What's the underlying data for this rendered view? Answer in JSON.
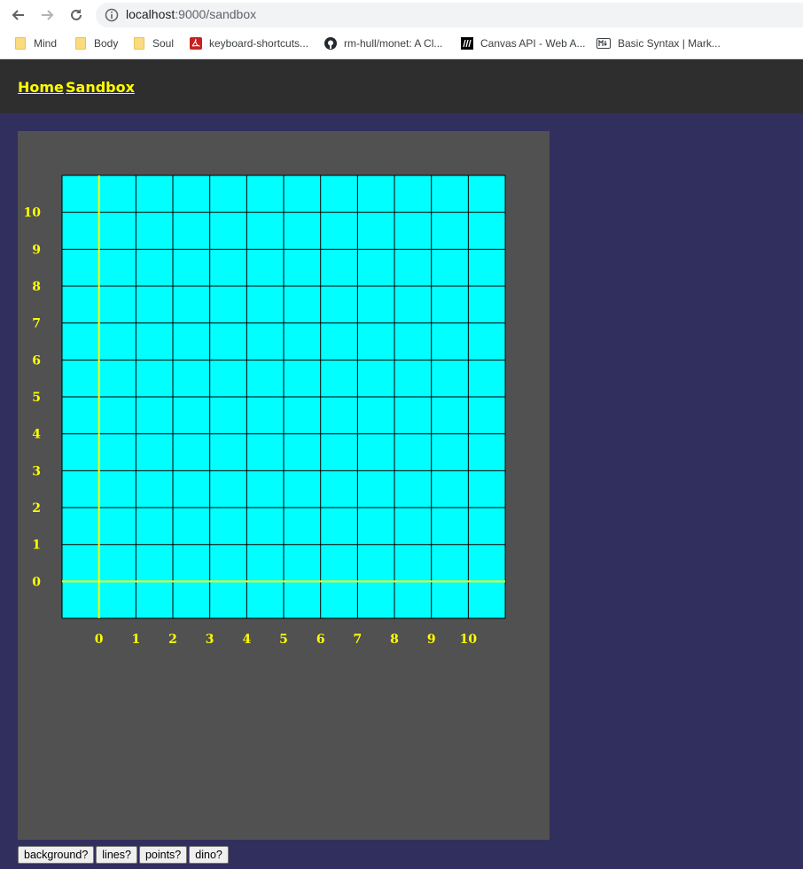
{
  "browser": {
    "url_host": "localhost",
    "url_rest": ":9000/sandbox",
    "bookmarks": [
      {
        "label": "Mind",
        "icon": "folder-icon"
      },
      {
        "label": "Body",
        "icon": "folder-icon"
      },
      {
        "label": "Soul",
        "icon": "folder-icon"
      },
      {
        "label": "keyboard-shortcuts...",
        "icon": "pdf-icon"
      },
      {
        "label": "rm-hull/monet: A Cl...",
        "icon": "github-icon"
      },
      {
        "label": "Canvas API - Web A...",
        "icon": "mdn-icon"
      },
      {
        "label": "Basic Syntax | Mark...",
        "icon": "markdown-icon"
      }
    ]
  },
  "nav": {
    "home": "Home",
    "sandbox": "Sandbox"
  },
  "grid": {
    "background_color": "#00ffff",
    "axis_color": "#ffff00",
    "label_color": "#ffff00",
    "line_color": "#000000",
    "x_labels": [
      "0",
      "1",
      "2",
      "3",
      "4",
      "5",
      "6",
      "7",
      "8",
      "9",
      "10"
    ],
    "y_labels": [
      "10",
      "9",
      "8",
      "7",
      "6",
      "5",
      "4",
      "3",
      "2",
      "1",
      "0"
    ]
  },
  "buttons": {
    "background": "background?",
    "lines": "lines?",
    "points": "points?",
    "dino": "dino?"
  }
}
